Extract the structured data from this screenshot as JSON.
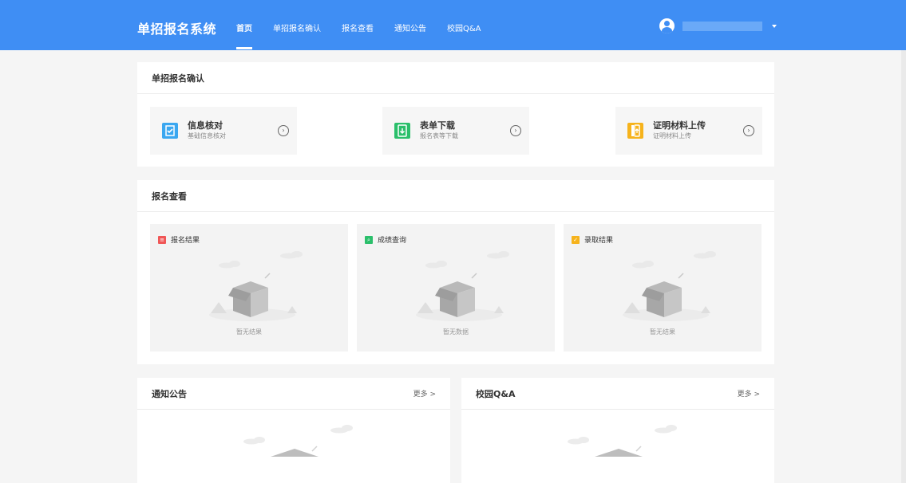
{
  "brand": "单招报名系统",
  "nav": {
    "items": [
      {
        "label": "首页"
      },
      {
        "label": "单招报名确认"
      },
      {
        "label": "报名查看"
      },
      {
        "label": "通知公告"
      },
      {
        "label": "校园Q&A"
      }
    ]
  },
  "user": {
    "avatar_icon": "user-avatar-icon",
    "caret_icon": "caret-down-icon"
  },
  "confirm_section": {
    "title": "单招报名确认",
    "items": [
      {
        "title": "信息核对",
        "subtitle": "基础信息核对",
        "icon": "check-list-icon",
        "icon_color": "#3aa7f0",
        "arrow_icon": "circle-chevron-right-icon",
        "arrow_glyph": "›"
      },
      {
        "title": "表单下载",
        "subtitle": "报名表等下载",
        "icon": "download-doc-icon",
        "icon_color": "#2bbf6b",
        "arrow_icon": "circle-chevron-right-icon",
        "arrow_glyph": "›"
      },
      {
        "title": "证明材料上传",
        "subtitle": "证明材料上传",
        "icon": "upload-doc-icon",
        "icon_color": "#f6b31c",
        "arrow_icon": "circle-chevron-right-icon",
        "arrow_glyph": "›"
      }
    ]
  },
  "view_section": {
    "title": "报名查看",
    "panels": [
      {
        "label": "报名结果",
        "icon": "result-doc-icon",
        "icon_color": "#f05656",
        "empty_text": "暂无结果"
      },
      {
        "label": "成绩查询",
        "icon": "search-doc-icon",
        "icon_color": "#2bbf6b",
        "empty_text": "暂无数据"
      },
      {
        "label": "录取结果",
        "icon": "admission-doc-icon",
        "icon_color": "#f6b31c",
        "empty_text": "暂无结果"
      }
    ]
  },
  "notice_section": {
    "title": "通知公告",
    "more_label": "更多 >"
  },
  "qa_section": {
    "title": "校园Q&A",
    "more_label": "更多 >"
  },
  "colors": {
    "header_bg": "#3f8ef4",
    "page_bg": "#f5f5f5"
  }
}
